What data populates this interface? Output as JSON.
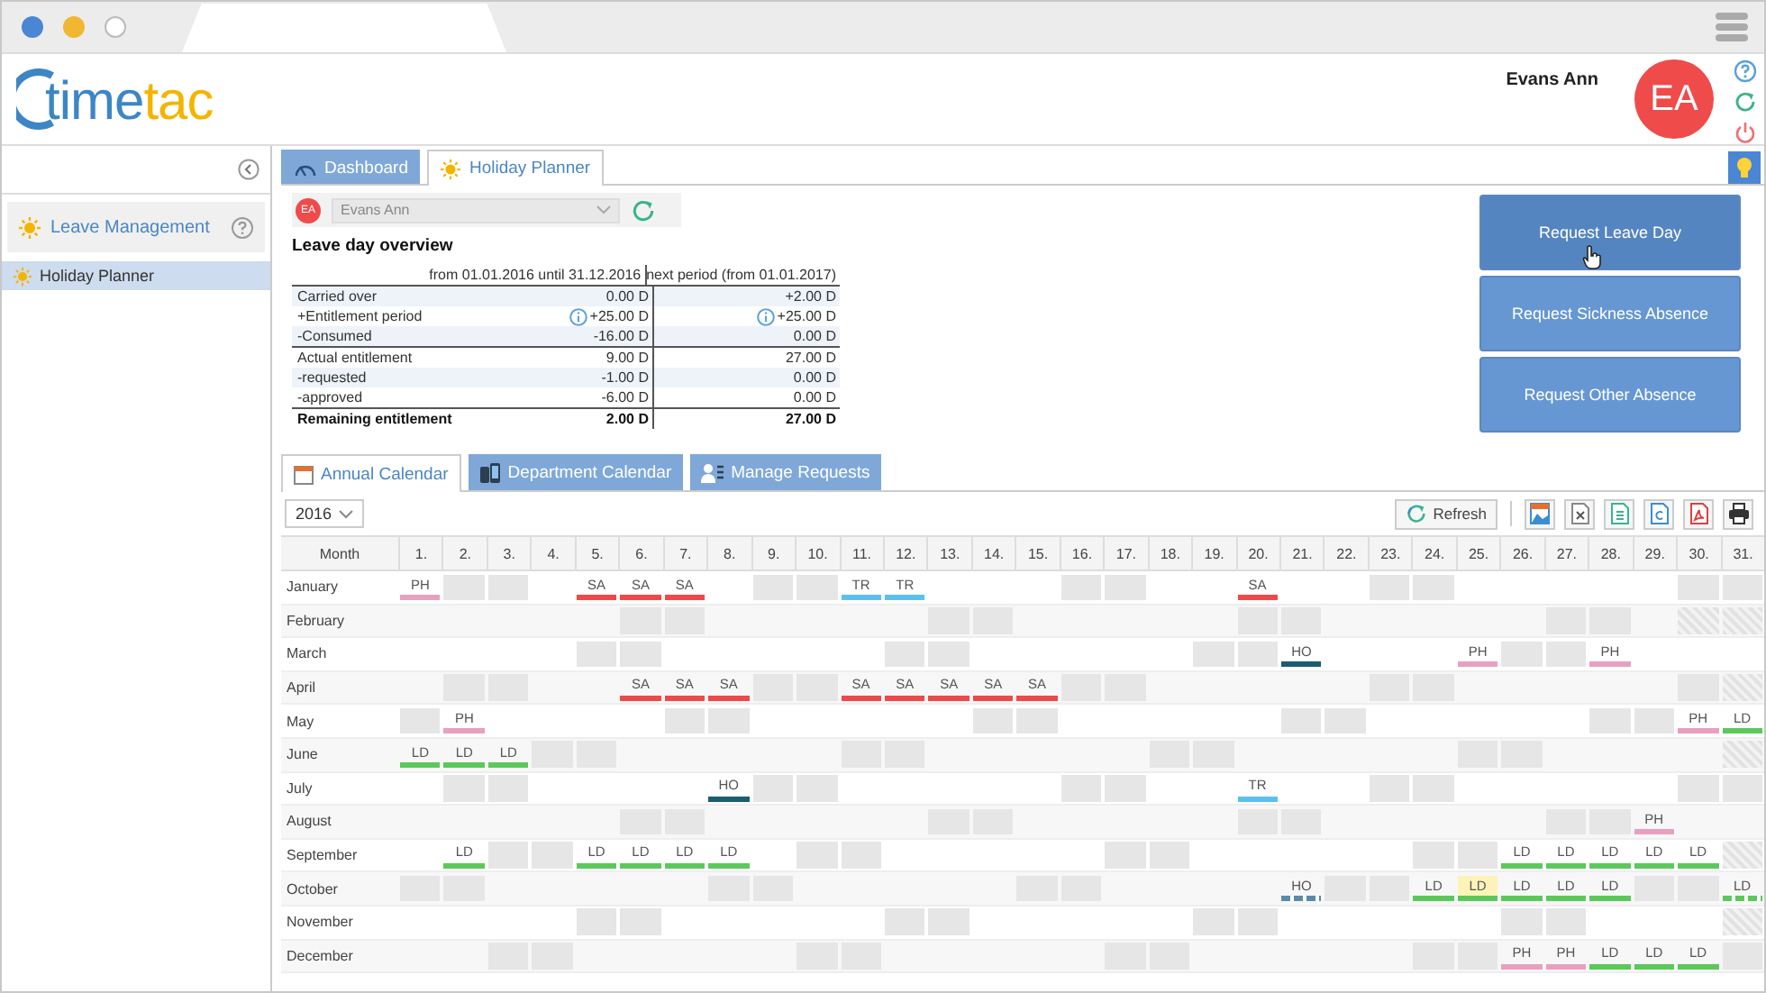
{
  "logo": {
    "part_1": "time",
    "part_2": "tac"
  },
  "user": {
    "name": "Evans Ann",
    "initials": "EA"
  },
  "sidebar": {
    "section": {
      "label": "Leave Management"
    },
    "items": [
      {
        "label": "Holiday Planner",
        "selected": true
      }
    ]
  },
  "tabs": [
    {
      "label": "Dashboard",
      "selected": false,
      "kind": "dashboard"
    },
    {
      "label": "Holiday Planner",
      "selected": true,
      "kind": "planner"
    }
  ],
  "employee_select": {
    "initials": "EA",
    "value": "Evans Ann"
  },
  "overview": {
    "title": "Leave day overview",
    "columns": [
      "from 01.01.2016 until 31.12.2016",
      "next period (from 01.01.2017)"
    ],
    "rows": [
      {
        "label": "Carried over",
        "values": [
          "0.00 D",
          "+2.00 D"
        ],
        "kind": "plain"
      },
      {
        "label": "+Entitlement period",
        "values": [
          "+25.00 D",
          "+25.00 D"
        ],
        "kind": "info"
      },
      {
        "label": "-Consumed",
        "values": [
          "-16.00 D",
          "0.00 D"
        ],
        "kind": "plain"
      },
      {
        "label": "Actual entitlement",
        "values": [
          "9.00 D",
          "27.00 D"
        ],
        "kind": "group"
      },
      {
        "label": "-requested",
        "values": [
          "-1.00 D",
          "0.00 D"
        ],
        "kind": "plain"
      },
      {
        "label": "-approved",
        "values": [
          "-6.00 D",
          "0.00 D"
        ],
        "kind": "plain"
      },
      {
        "label": "Remaining entitlement",
        "values": [
          "2.00 D",
          "27.00 D"
        ],
        "kind": "total"
      }
    ]
  },
  "actions": [
    {
      "label": "Request Leave Day",
      "hovered": true
    },
    {
      "label": "Request Sickness Absence",
      "hovered": false
    },
    {
      "label": "Request Other Absence",
      "hovered": false
    }
  ],
  "subtabs": [
    {
      "label": "Annual Calendar",
      "selected": true,
      "kind": "calendar"
    },
    {
      "label": "Department Calendar",
      "selected": false,
      "kind": "department"
    },
    {
      "label": "Manage Requests",
      "selected": false,
      "kind": "requests"
    }
  ],
  "year_select": {
    "value": "2016"
  },
  "refresh_button": {
    "label": "Refresh"
  },
  "calendar": {
    "month_header": "Month",
    "day_headers": [
      "1.",
      "2.",
      "3.",
      "4.",
      "5.",
      "6.",
      "7.",
      "8.",
      "9.",
      "10.",
      "11.",
      "12.",
      "13.",
      "14.",
      "15.",
      "16.",
      "17.",
      "18.",
      "19.",
      "20.",
      "21.",
      "22.",
      "23.",
      "24.",
      "25.",
      "26.",
      "27.",
      "28.",
      "29.",
      "30.",
      "31."
    ],
    "months": [
      {
        "name": "January",
        "days": [
          {
            "kind": "absence",
            "code": "PH",
            "color": "#e8a0c0",
            "requested": false,
            "highlighted": false
          },
          {
            "kind": "weekend"
          },
          {
            "kind": "weekend"
          },
          {
            "kind": "workday"
          },
          {
            "kind": "absence",
            "code": "SA",
            "color": "#f04848",
            "requested": false,
            "highlighted": false
          },
          {
            "kind": "absence",
            "code": "SA",
            "color": "#f04848",
            "requested": false,
            "highlighted": false
          },
          {
            "kind": "absence",
            "code": "SA",
            "color": "#f04848",
            "requested": false,
            "highlighted": false
          },
          {
            "kind": "workday"
          },
          {
            "kind": "weekend"
          },
          {
            "kind": "weekend"
          },
          {
            "kind": "absence",
            "code": "TR",
            "color": "#5bc0f0",
            "requested": false,
            "highlighted": false
          },
          {
            "kind": "absence",
            "code": "TR",
            "color": "#5bc0f0",
            "requested": false,
            "highlighted": false
          },
          {
            "kind": "workday"
          },
          {
            "kind": "workday"
          },
          {
            "kind": "workday"
          },
          {
            "kind": "weekend"
          },
          {
            "kind": "weekend"
          },
          {
            "kind": "workday"
          },
          {
            "kind": "workday"
          },
          {
            "kind": "absence",
            "code": "SA",
            "color": "#f04848",
            "requested": false,
            "highlighted": false
          },
          {
            "kind": "workday"
          },
          {
            "kind": "workday"
          },
          {
            "kind": "weekend"
          },
          {
            "kind": "weekend"
          },
          {
            "kind": "workday"
          },
          {
            "kind": "workday"
          },
          {
            "kind": "workday"
          },
          {
            "kind": "workday"
          },
          {
            "kind": "workday"
          },
          {
            "kind": "weekend"
          },
          {
            "kind": "weekend"
          }
        ]
      },
      {
        "name": "February",
        "days": [
          {
            "kind": "workday"
          },
          {
            "kind": "workday"
          },
          {
            "kind": "workday"
          },
          {
            "kind": "workday"
          },
          {
            "kind": "workday"
          },
          {
            "kind": "weekend"
          },
          {
            "kind": "weekend"
          },
          {
            "kind": "workday"
          },
          {
            "kind": "workday"
          },
          {
            "kind": "workday"
          },
          {
            "kind": "workday"
          },
          {
            "kind": "workday"
          },
          {
            "kind": "weekend"
          },
          {
            "kind": "weekend"
          },
          {
            "kind": "workday"
          },
          {
            "kind": "workday"
          },
          {
            "kind": "workday"
          },
          {
            "kind": "workday"
          },
          {
            "kind": "workday"
          },
          {
            "kind": "weekend"
          },
          {
            "kind": "weekend"
          },
          {
            "kind": "workday"
          },
          {
            "kind": "workday"
          },
          {
            "kind": "workday"
          },
          {
            "kind": "workday"
          },
          {
            "kind": "workday"
          },
          {
            "kind": "weekend"
          },
          {
            "kind": "weekend"
          },
          {
            "kind": "workday"
          },
          {
            "kind": "none"
          },
          {
            "kind": "none"
          }
        ]
      },
      {
        "name": "March",
        "days": [
          {
            "kind": "workday"
          },
          {
            "kind": "workday"
          },
          {
            "kind": "workday"
          },
          {
            "kind": "workday"
          },
          {
            "kind": "weekend"
          },
          {
            "kind": "weekend"
          },
          {
            "kind": "workday"
          },
          {
            "kind": "workday"
          },
          {
            "kind": "workday"
          },
          {
            "kind": "workday"
          },
          {
            "kind": "workday"
          },
          {
            "kind": "weekend"
          },
          {
            "kind": "weekend"
          },
          {
            "kind": "workday"
          },
          {
            "kind": "workday"
          },
          {
            "kind": "workday"
          },
          {
            "kind": "workday"
          },
          {
            "kind": "workday"
          },
          {
            "kind": "weekend"
          },
          {
            "kind": "weekend"
          },
          {
            "kind": "absence",
            "code": "HO",
            "color": "#1a5e70",
            "requested": false,
            "highlighted": false
          },
          {
            "kind": "workday"
          },
          {
            "kind": "workday"
          },
          {
            "kind": "workday"
          },
          {
            "kind": "absence",
            "code": "PH",
            "color": "#e8a0c0",
            "requested": false,
            "highlighted": false
          },
          {
            "kind": "weekend"
          },
          {
            "kind": "weekend"
          },
          {
            "kind": "absence",
            "code": "PH",
            "color": "#e8a0c0",
            "requested": false,
            "highlighted": false
          },
          {
            "kind": "workday"
          },
          {
            "kind": "workday"
          },
          {
            "kind": "workday"
          }
        ]
      },
      {
        "name": "April",
        "days": [
          {
            "kind": "workday"
          },
          {
            "kind": "weekend"
          },
          {
            "kind": "weekend"
          },
          {
            "kind": "workday"
          },
          {
            "kind": "workday"
          },
          {
            "kind": "absence",
            "code": "SA",
            "color": "#f04848",
            "requested": false,
            "highlighted": false
          },
          {
            "kind": "absence",
            "code": "SA",
            "color": "#f04848",
            "requested": false,
            "highlighted": false
          },
          {
            "kind": "absence",
            "code": "SA",
            "color": "#f04848",
            "requested": false,
            "highlighted": false
          },
          {
            "kind": "weekend"
          },
          {
            "kind": "weekend"
          },
          {
            "kind": "absence",
            "code": "SA",
            "color": "#f04848",
            "requested": false,
            "highlighted": false
          },
          {
            "kind": "absence",
            "code": "SA",
            "color": "#f04848",
            "requested": false,
            "highlighted": false
          },
          {
            "kind": "absence",
            "code": "SA",
            "color": "#f04848",
            "requested": false,
            "highlighted": false
          },
          {
            "kind": "absence",
            "code": "SA",
            "color": "#f04848",
            "requested": false,
            "highlighted": false
          },
          {
            "kind": "absence",
            "code": "SA",
            "color": "#f04848",
            "requested": false,
            "highlighted": false
          },
          {
            "kind": "weekend"
          },
          {
            "kind": "weekend"
          },
          {
            "kind": "workday"
          },
          {
            "kind": "workday"
          },
          {
            "kind": "workday"
          },
          {
            "kind": "workday"
          },
          {
            "kind": "workday"
          },
          {
            "kind": "weekend"
          },
          {
            "kind": "weekend"
          },
          {
            "kind": "workday"
          },
          {
            "kind": "workday"
          },
          {
            "kind": "workday"
          },
          {
            "kind": "workday"
          },
          {
            "kind": "workday"
          },
          {
            "kind": "weekend"
          },
          {
            "kind": "none"
          }
        ]
      },
      {
        "name": "May",
        "days": [
          {
            "kind": "weekend"
          },
          {
            "kind": "absence",
            "code": "PH",
            "color": "#e8a0c0",
            "requested": false,
            "highlighted": false
          },
          {
            "kind": "workday"
          },
          {
            "kind": "workday"
          },
          {
            "kind": "workday"
          },
          {
            "kind": "workday"
          },
          {
            "kind": "weekend"
          },
          {
            "kind": "weekend"
          },
          {
            "kind": "workday"
          },
          {
            "kind": "workday"
          },
          {
            "kind": "workday"
          },
          {
            "kind": "workday"
          },
          {
            "kind": "workday"
          },
          {
            "kind": "weekend"
          },
          {
            "kind": "weekend"
          },
          {
            "kind": "workday"
          },
          {
            "kind": "workday"
          },
          {
            "kind": "workday"
          },
          {
            "kind": "workday"
          },
          {
            "kind": "workday"
          },
          {
            "kind": "weekend"
          },
          {
            "kind": "weekend"
          },
          {
            "kind": "workday"
          },
          {
            "kind": "workday"
          },
          {
            "kind": "workday"
          },
          {
            "kind": "workday"
          },
          {
            "kind": "workday"
          },
          {
            "kind": "weekend"
          },
          {
            "kind": "weekend"
          },
          {
            "kind": "absence",
            "code": "PH",
            "color": "#e8a0c0",
            "requested": false,
            "highlighted": false
          },
          {
            "kind": "absence",
            "code": "LD",
            "color": "#5cc85c",
            "requested": false,
            "highlighted": false
          }
        ]
      },
      {
        "name": "June",
        "days": [
          {
            "kind": "absence",
            "code": "LD",
            "color": "#5cc85c",
            "requested": false,
            "highlighted": false
          },
          {
            "kind": "absence",
            "code": "LD",
            "color": "#5cc85c",
            "requested": false,
            "highlighted": false
          },
          {
            "kind": "absence",
            "code": "LD",
            "color": "#5cc85c",
            "requested": false,
            "highlighted": false
          },
          {
            "kind": "weekend"
          },
          {
            "kind": "weekend"
          },
          {
            "kind": "workday"
          },
          {
            "kind": "workday"
          },
          {
            "kind": "workday"
          },
          {
            "kind": "workday"
          },
          {
            "kind": "workday"
          },
          {
            "kind": "weekend"
          },
          {
            "kind": "weekend"
          },
          {
            "kind": "workday"
          },
          {
            "kind": "workday"
          },
          {
            "kind": "workday"
          },
          {
            "kind": "workday"
          },
          {
            "kind": "workday"
          },
          {
            "kind": "weekend"
          },
          {
            "kind": "weekend"
          },
          {
            "kind": "workday"
          },
          {
            "kind": "workday"
          },
          {
            "kind": "workday"
          },
          {
            "kind": "workday"
          },
          {
            "kind": "workday"
          },
          {
            "kind": "weekend"
          },
          {
            "kind": "weekend"
          },
          {
            "kind": "workday"
          },
          {
            "kind": "workday"
          },
          {
            "kind": "workday"
          },
          {
            "kind": "workday"
          },
          {
            "kind": "none"
          }
        ]
      },
      {
        "name": "July",
        "days": [
          {
            "kind": "workday"
          },
          {
            "kind": "weekend"
          },
          {
            "kind": "weekend"
          },
          {
            "kind": "workday"
          },
          {
            "kind": "workday"
          },
          {
            "kind": "workday"
          },
          {
            "kind": "workday"
          },
          {
            "kind": "absence",
            "code": "HO",
            "color": "#1a5e70",
            "requested": false,
            "highlighted": false
          },
          {
            "kind": "weekend"
          },
          {
            "kind": "weekend"
          },
          {
            "kind": "workday"
          },
          {
            "kind": "workday"
          },
          {
            "kind": "workday"
          },
          {
            "kind": "workday"
          },
          {
            "kind": "workday"
          },
          {
            "kind": "weekend"
          },
          {
            "kind": "weekend"
          },
          {
            "kind": "workday"
          },
          {
            "kind": "workday"
          },
          {
            "kind": "absence",
            "code": "TR",
            "color": "#5bc0f0",
            "requested": false,
            "highlighted": false
          },
          {
            "kind": "workday"
          },
          {
            "kind": "workday"
          },
          {
            "kind": "weekend"
          },
          {
            "kind": "weekend"
          },
          {
            "kind": "workday"
          },
          {
            "kind": "workday"
          },
          {
            "kind": "workday"
          },
          {
            "kind": "workday"
          },
          {
            "kind": "workday"
          },
          {
            "kind": "weekend"
          },
          {
            "kind": "weekend"
          }
        ]
      },
      {
        "name": "August",
        "days": [
          {
            "kind": "workday"
          },
          {
            "kind": "workday"
          },
          {
            "kind": "workday"
          },
          {
            "kind": "workday"
          },
          {
            "kind": "workday"
          },
          {
            "kind": "weekend"
          },
          {
            "kind": "weekend"
          },
          {
            "kind": "workday"
          },
          {
            "kind": "workday"
          },
          {
            "kind": "workday"
          },
          {
            "kind": "workday"
          },
          {
            "kind": "workday"
          },
          {
            "kind": "weekend"
          },
          {
            "kind": "weekend"
          },
          {
            "kind": "workday"
          },
          {
            "kind": "workday"
          },
          {
            "kind": "workday"
          },
          {
            "kind": "workday"
          },
          {
            "kind": "workday"
          },
          {
            "kind": "weekend"
          },
          {
            "kind": "weekend"
          },
          {
            "kind": "workday"
          },
          {
            "kind": "workday"
          },
          {
            "kind": "workday"
          },
          {
            "kind": "workday"
          },
          {
            "kind": "workday"
          },
          {
            "kind": "weekend"
          },
          {
            "kind": "weekend"
          },
          {
            "kind": "absence",
            "code": "PH",
            "color": "#e8a0c0",
            "requested": false,
            "highlighted": false
          },
          {
            "kind": "workday"
          },
          {
            "kind": "workday"
          }
        ]
      },
      {
        "name": "September",
        "days": [
          {
            "kind": "workday"
          },
          {
            "kind": "absence",
            "code": "LD",
            "color": "#5cc85c",
            "requested": false,
            "highlighted": false
          },
          {
            "kind": "weekend"
          },
          {
            "kind": "weekend"
          },
          {
            "kind": "absence",
            "code": "LD",
            "color": "#5cc85c",
            "requested": false,
            "highlighted": false
          },
          {
            "kind": "absence",
            "code": "LD",
            "color": "#5cc85c",
            "requested": false,
            "highlighted": false
          },
          {
            "kind": "absence",
            "code": "LD",
            "color": "#5cc85c",
            "requested": false,
            "highlighted": false
          },
          {
            "kind": "absence",
            "code": "LD",
            "color": "#5cc85c",
            "requested": false,
            "highlighted": false
          },
          {
            "kind": "workday"
          },
          {
            "kind": "weekend"
          },
          {
            "kind": "weekend"
          },
          {
            "kind": "workday"
          },
          {
            "kind": "workday"
          },
          {
            "kind": "workday"
          },
          {
            "kind": "workday"
          },
          {
            "kind": "workday"
          },
          {
            "kind": "weekend"
          },
          {
            "kind": "weekend"
          },
          {
            "kind": "workday"
          },
          {
            "kind": "workday"
          },
          {
            "kind": "workday"
          },
          {
            "kind": "workday"
          },
          {
            "kind": "workday"
          },
          {
            "kind": "weekend"
          },
          {
            "kind": "weekend"
          },
          {
            "kind": "absence",
            "code": "LD",
            "color": "#5cc85c",
            "requested": false,
            "highlighted": false
          },
          {
            "kind": "absence",
            "code": "LD",
            "color": "#5cc85c",
            "requested": false,
            "highlighted": false
          },
          {
            "kind": "absence",
            "code": "LD",
            "color": "#5cc85c",
            "requested": false,
            "highlighted": false
          },
          {
            "kind": "absence",
            "code": "LD",
            "color": "#5cc85c",
            "requested": false,
            "highlighted": false
          },
          {
            "kind": "absence",
            "code": "LD",
            "color": "#5cc85c",
            "requested": false,
            "highlighted": false
          },
          {
            "kind": "none"
          }
        ]
      },
      {
        "name": "October",
        "days": [
          {
            "kind": "weekend"
          },
          {
            "kind": "weekend"
          },
          {
            "kind": "workday"
          },
          {
            "kind": "workday"
          },
          {
            "kind": "workday"
          },
          {
            "kind": "workday"
          },
          {
            "kind": "workday"
          },
          {
            "kind": "weekend"
          },
          {
            "kind": "weekend"
          },
          {
            "kind": "workday"
          },
          {
            "kind": "workday"
          },
          {
            "kind": "workday"
          },
          {
            "kind": "workday"
          },
          {
            "kind": "workday"
          },
          {
            "kind": "weekend"
          },
          {
            "kind": "weekend"
          },
          {
            "kind": "workday"
          },
          {
            "kind": "workday"
          },
          {
            "kind": "workday"
          },
          {
            "kind": "workday"
          },
          {
            "kind": "absence",
            "code": "HO",
            "color": "#5a8aaa",
            "requested": true,
            "highlighted": false
          },
          {
            "kind": "weekend"
          },
          {
            "kind": "weekend"
          },
          {
            "kind": "absence",
            "code": "LD",
            "color": "#5cc85c",
            "requested": false,
            "highlighted": false
          },
          {
            "kind": "absence",
            "code": "LD",
            "color": "#5cc85c",
            "requested": false,
            "highlighted": true
          },
          {
            "kind": "absence",
            "code": "LD",
            "color": "#5cc85c",
            "requested": false,
            "highlighted": false
          },
          {
            "kind": "absence",
            "code": "LD",
            "color": "#5cc85c",
            "requested": false,
            "highlighted": false
          },
          {
            "kind": "absence",
            "code": "LD",
            "color": "#5cc85c",
            "requested": false,
            "highlighted": false
          },
          {
            "kind": "weekend"
          },
          {
            "kind": "weekend"
          },
          {
            "kind": "absence",
            "code": "LD",
            "color": "#5cc85c",
            "requested": true,
            "highlighted": false
          }
        ]
      },
      {
        "name": "November",
        "days": [
          {
            "kind": "workday"
          },
          {
            "kind": "workday"
          },
          {
            "kind": "workday"
          },
          {
            "kind": "workday"
          },
          {
            "kind": "weekend"
          },
          {
            "kind": "weekend"
          },
          {
            "kind": "workday"
          },
          {
            "kind": "workday"
          },
          {
            "kind": "workday"
          },
          {
            "kind": "workday"
          },
          {
            "kind": "workday"
          },
          {
            "kind": "weekend"
          },
          {
            "kind": "weekend"
          },
          {
            "kind": "workday"
          },
          {
            "kind": "workday"
          },
          {
            "kind": "workday"
          },
          {
            "kind": "workday"
          },
          {
            "kind": "workday"
          },
          {
            "kind": "weekend"
          },
          {
            "kind": "weekend"
          },
          {
            "kind": "workday"
          },
          {
            "kind": "workday"
          },
          {
            "kind": "workday"
          },
          {
            "kind": "workday"
          },
          {
            "kind": "workday"
          },
          {
            "kind": "weekend"
          },
          {
            "kind": "weekend"
          },
          {
            "kind": "workday"
          },
          {
            "kind": "workday"
          },
          {
            "kind": "workday"
          },
          {
            "kind": "none"
          }
        ]
      },
      {
        "name": "December",
        "days": [
          {
            "kind": "workday"
          },
          {
            "kind": "workday"
          },
          {
            "kind": "weekend"
          },
          {
            "kind": "weekend"
          },
          {
            "kind": "workday"
          },
          {
            "kind": "workday"
          },
          {
            "kind": "workday"
          },
          {
            "kind": "workday"
          },
          {
            "kind": "workday"
          },
          {
            "kind": "weekend"
          },
          {
            "kind": "weekend"
          },
          {
            "kind": "workday"
          },
          {
            "kind": "workday"
          },
          {
            "kind": "workday"
          },
          {
            "kind": "workday"
          },
          {
            "kind": "workday"
          },
          {
            "kind": "weekend"
          },
          {
            "kind": "weekend"
          },
          {
            "kind": "workday"
          },
          {
            "kind": "workday"
          },
          {
            "kind": "workday"
          },
          {
            "kind": "workday"
          },
          {
            "kind": "workday"
          },
          {
            "kind": "weekend"
          },
          {
            "kind": "weekend"
          },
          {
            "kind": "absence",
            "code": "PH",
            "color": "#e8a0c0",
            "requested": false,
            "highlighted": false
          },
          {
            "kind": "absence",
            "code": "PH",
            "color": "#e8a0c0",
            "requested": false,
            "highlighted": false
          },
          {
            "kind": "absence",
            "code": "LD",
            "color": "#5cc85c",
            "requested": false,
            "highlighted": false
          },
          {
            "kind": "absence",
            "code": "LD",
            "color": "#5cc85c",
            "requested": false,
            "highlighted": false
          },
          {
            "kind": "absence",
            "code": "LD",
            "color": "#5cc85c",
            "requested": false,
            "highlighted": false
          },
          {
            "kind": "weekend"
          }
        ]
      }
    ]
  }
}
